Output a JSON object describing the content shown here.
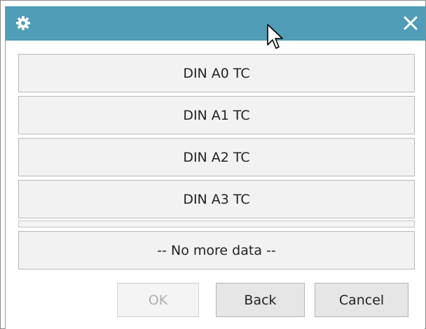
{
  "titlebar": {
    "icon": "gear-icon",
    "close_icon": "close-icon",
    "background": "#4f9db6"
  },
  "list": {
    "items": [
      {
        "label": "DIN A0 TC"
      },
      {
        "label": "DIN A1 TC"
      },
      {
        "label": "DIN A2 TC"
      },
      {
        "label": "DIN A3 TC"
      }
    ],
    "no_more_label": "-- No more data --"
  },
  "buttons": {
    "ok_label": "OK",
    "back_label": "Back",
    "cancel_label": "Cancel"
  }
}
